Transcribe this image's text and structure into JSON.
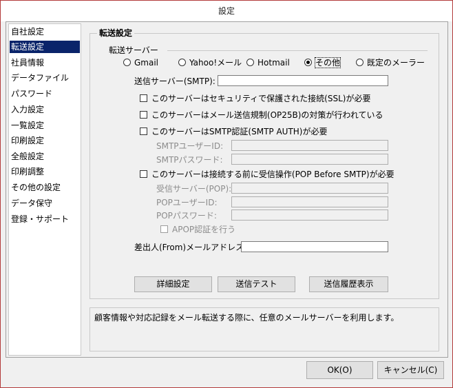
{
  "window": {
    "title": "設定"
  },
  "sidebar": {
    "items": [
      {
        "label": "自社設定"
      },
      {
        "label": "転送設定",
        "selected": true
      },
      {
        "label": "社員情報"
      },
      {
        "label": "データファイル"
      },
      {
        "label": "パスワード"
      },
      {
        "label": "入力設定"
      },
      {
        "label": "一覧設定"
      },
      {
        "label": "印刷設定"
      },
      {
        "label": "全般設定"
      },
      {
        "label": "印刷調整"
      },
      {
        "label": "その他の設定"
      },
      {
        "label": "データ保守"
      },
      {
        "label": "登録・サポート"
      }
    ]
  },
  "transfer": {
    "group_title": "転送設定",
    "server_legend": "転送サーバー",
    "radios": [
      {
        "label": "Gmail",
        "checked": false
      },
      {
        "label": "Yahoo!メール",
        "checked": false
      },
      {
        "label": "Hotmail",
        "checked": false
      },
      {
        "label": "その他",
        "checked": true
      },
      {
        "label": "既定のメーラー",
        "checked": false
      }
    ],
    "smtp_label": "送信サーバー(SMTP):",
    "smtp_value": "",
    "ssl_label": "このサーバーはセキュリティで保護された接続(SSL)が必要",
    "op25b_label": "このサーバーはメール送信規制(OP25B)の対策が行われている",
    "smtp_auth_label": "このサーバーはSMTP認証(SMTP AUTH)が必要",
    "smtp_user_label": "SMTPユーザーID:",
    "smtp_pass_label": "SMTPパスワード:",
    "pop_before_label": "このサーバーは接続する前に受信操作(POP Before SMTP)が必要",
    "pop_server_label": "受信サーバー(POP):",
    "pop_user_label": "POPユーザーID:",
    "pop_pass_label": "POPパスワード:",
    "apop_label": "APOP認証を行う",
    "from_label": "差出人(From)メールアドレス:",
    "from_value": "",
    "buttons": {
      "detail": "詳細設定",
      "test": "送信テスト",
      "history": "送信履歴表示"
    }
  },
  "description": "顧客情報や対応記録をメール転送する際に、任意のメールサーバーを利用します。",
  "footer": {
    "ok": "OK(O)",
    "cancel": "キャンセル(C)"
  }
}
